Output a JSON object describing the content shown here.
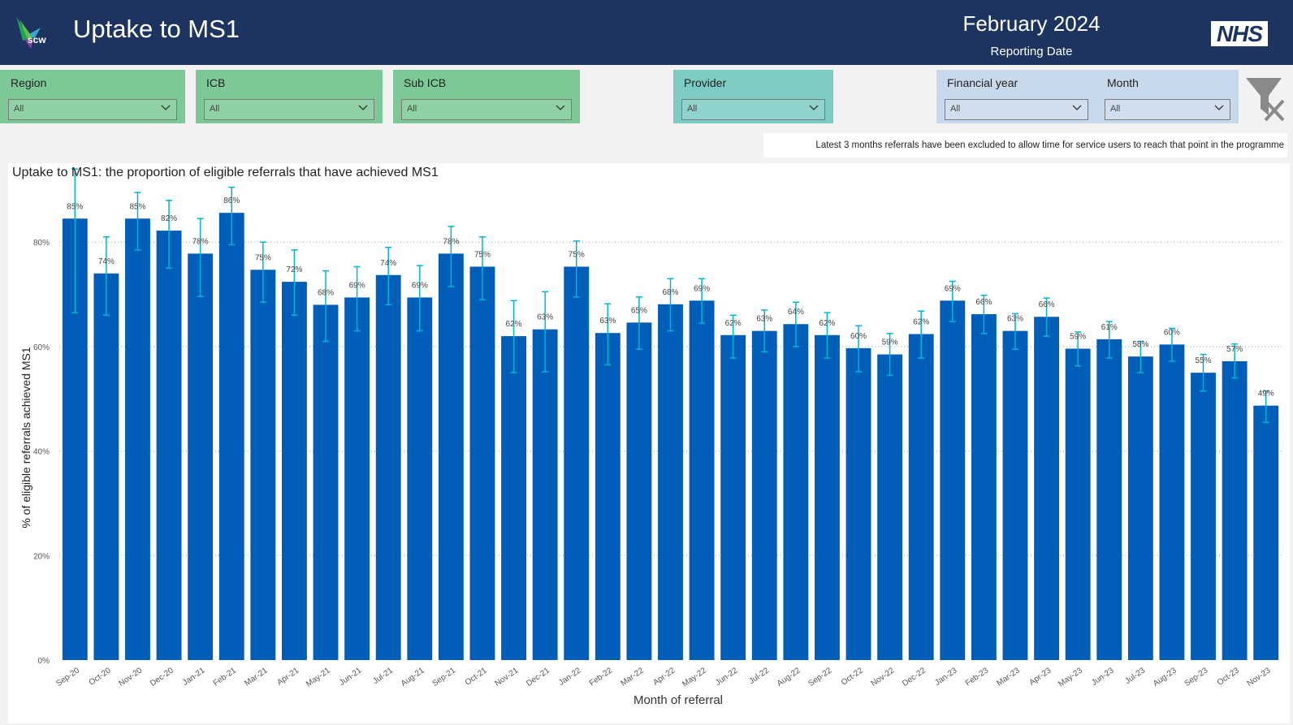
{
  "header": {
    "logo_text": "scw",
    "title": "Uptake to MS1",
    "report_month": "February 2024",
    "report_label": "Reporting Date",
    "nhs_logo": "NHS"
  },
  "filters": [
    {
      "label": "Region",
      "value": "All"
    },
    {
      "label": "ICB",
      "value": "All"
    },
    {
      "label": "Sub ICB",
      "value": "All"
    },
    {
      "label": "Provider",
      "value": "All"
    },
    {
      "label": "Financial year",
      "value": "All"
    },
    {
      "label": "Month",
      "value": "All"
    }
  ],
  "note": "Latest 3 months referrals have been excluded to allow time for service users to reach that point in the programme",
  "colors": {
    "header": "#1d3461",
    "bar": "#005eb8",
    "error_bar": "#00b4d8",
    "slicer_green": "#7dc896",
    "slicer_teal": "#7cccc4",
    "slicer_blue": "#c9d9ec"
  },
  "chart_data": {
    "type": "bar",
    "title": "Uptake to MS1: the proportion of eligible referrals that have achieved MS1",
    "xlabel": "Month of referral",
    "ylabel": "% of eligible referrals achieved MS1",
    "ylim": [
      0,
      0.92
    ],
    "yticks": [
      0,
      0.2,
      0.4,
      0.6,
      0.8
    ],
    "ytick_labels": [
      "0%",
      "20%",
      "40%",
      "60%",
      "80%"
    ],
    "grid": "horizontal dotted",
    "categories": [
      "Sep-20",
      "Oct-20",
      "Nov-20",
      "Dec-20",
      "Jan-21",
      "Feb-21",
      "Mar-21",
      "Apr-21",
      "May-21",
      "Jun-21",
      "Jul-21",
      "Aug-21",
      "Sep-21",
      "Oct-21",
      "Nov-21",
      "Dec-21",
      "Jan-22",
      "Feb-22",
      "Mar-22",
      "Apr-22",
      "May-22",
      "Jun-22",
      "Jul-22",
      "Aug-22",
      "Sep-22",
      "Oct-22",
      "Nov-22",
      "Dec-22",
      "Jan-23",
      "Feb-23",
      "Mar-23",
      "Apr-23",
      "May-23",
      "Jun-23",
      "Jul-23",
      "Aug-23",
      "Sep-23",
      "Oct-23",
      "Nov-23"
    ],
    "values": [
      0.845,
      0.74,
      0.845,
      0.822,
      0.778,
      0.856,
      0.747,
      0.724,
      0.68,
      0.694,
      0.737,
      0.694,
      0.778,
      0.753,
      0.62,
      0.633,
      0.753,
      0.626,
      0.646,
      0.681,
      0.688,
      0.622,
      0.63,
      0.643,
      0.622,
      0.597,
      0.585,
      0.624,
      0.688,
      0.662,
      0.63,
      0.657,
      0.596,
      0.614,
      0.581,
      0.604,
      0.55,
      0.572,
      0.487
    ],
    "data_labels": [
      "85%",
      "74%",
      "85%",
      "82%",
      "78%",
      "86%",
      "75%",
      "72%",
      "68%",
      "69%",
      "74%",
      "69%",
      "78%",
      "75%",
      "62%",
      "63%",
      "75%",
      "63%",
      "65%",
      "68%",
      "69%",
      "62%",
      "63%",
      "64%",
      "62%",
      "60%",
      "59%",
      "62%",
      "69%",
      "66%",
      "63%",
      "66%",
      "59%",
      "61%",
      "58%",
      "60%",
      "55%",
      "57%",
      "49%"
    ],
    "error_low": [
      0.665,
      0.66,
      0.785,
      0.75,
      0.696,
      0.795,
      0.685,
      0.66,
      0.61,
      0.63,
      0.68,
      0.63,
      0.715,
      0.69,
      0.55,
      0.552,
      0.695,
      0.565,
      0.595,
      0.63,
      0.645,
      0.578,
      0.59,
      0.6,
      0.578,
      0.552,
      0.545,
      0.578,
      0.648,
      0.625,
      0.595,
      0.62,
      0.563,
      0.578,
      0.55,
      0.572,
      0.515,
      0.54,
      0.455
    ],
    "error_high": [
      0.94,
      0.81,
      0.895,
      0.88,
      0.845,
      0.905,
      0.8,
      0.785,
      0.745,
      0.753,
      0.79,
      0.755,
      0.83,
      0.81,
      0.688,
      0.705,
      0.802,
      0.682,
      0.695,
      0.73,
      0.73,
      0.66,
      0.67,
      0.685,
      0.665,
      0.64,
      0.625,
      0.668,
      0.725,
      0.698,
      0.663,
      0.693,
      0.628,
      0.648,
      0.61,
      0.635,
      0.585,
      0.605,
      0.515
    ]
  }
}
